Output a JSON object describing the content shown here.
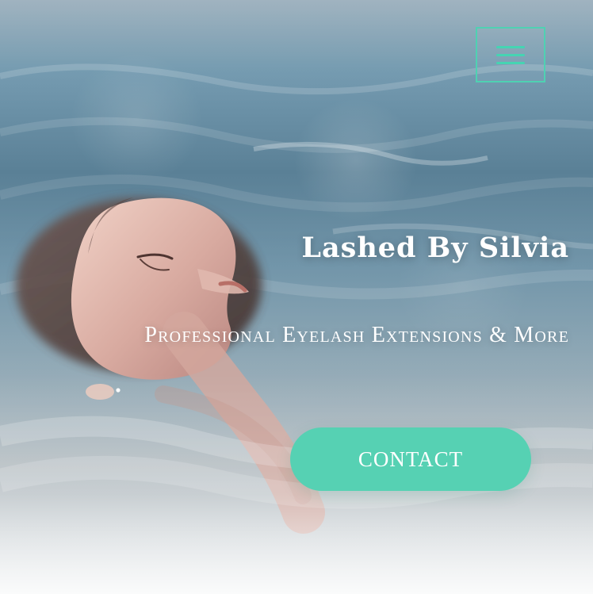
{
  "hero": {
    "title": "Lashed By Silvia",
    "subtitle": "Professional Eyelash Extensions & More",
    "contact_label": "CONTACT"
  },
  "navigation": {
    "menu_icon": "hamburger-menu-icon"
  },
  "colors": {
    "accent": "#56d1b3",
    "menu_border": "#4fd1b2",
    "text": "#ffffff"
  }
}
